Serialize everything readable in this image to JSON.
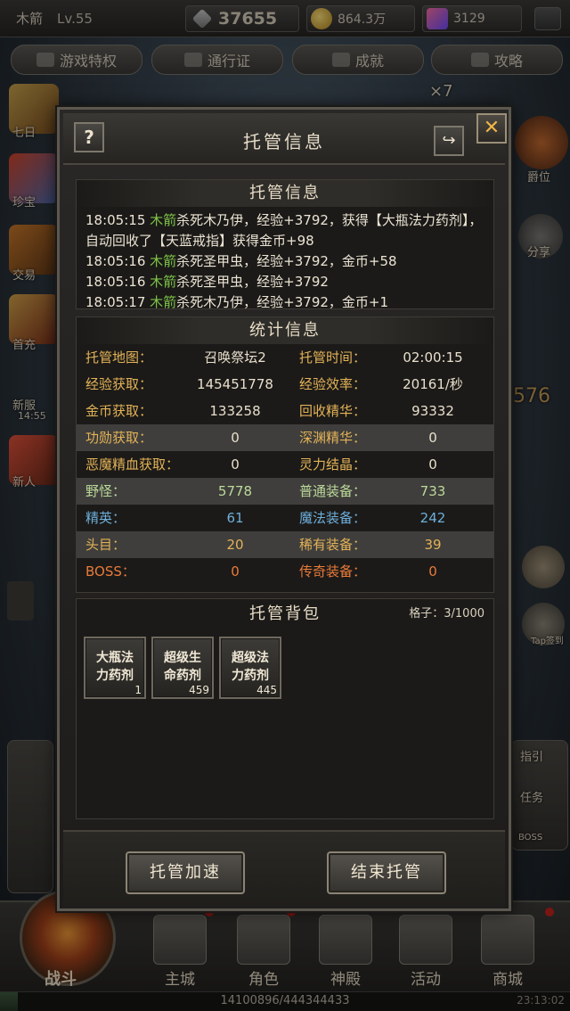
{
  "topbar": {
    "player_name": "木箭",
    "level": "Lv.55",
    "combat_power": "37655",
    "gold": "864.3万",
    "gems": "3129"
  },
  "menu": [
    "游戏特权",
    "通行证",
    "成就",
    "攻略"
  ],
  "side_labels": {
    "seven_day": "七日",
    "treasure": "珍宝",
    "auction": "交易",
    "first_charge": "首充",
    "new_server": "新服",
    "new_server_time": "14:55",
    "promo": "新人",
    "rank": "爵位",
    "share": "分享",
    "multiplier": "×7",
    "power_partial": "576",
    "tap_sign": "Tap签到",
    "guide": "指引",
    "task": "任务",
    "boss": "BOSS"
  },
  "dialog": {
    "title": "托管信息",
    "help_label": "?",
    "close_label": "✕",
    "share_label": "↪",
    "log_section": {
      "title": "托管信息",
      "entries": [
        {
          "time": "18:05:15",
          "name": "木箭",
          "text_before": "杀死木乃伊，经验+3792，获得【大瓶法力药剂】，自动回收了【天蓝戒指】获得金币+98"
        },
        {
          "time": "18:05:16",
          "name": "木箭",
          "text_before": "杀死圣甲虫，经验+3792，金币+58"
        },
        {
          "time": "18:05:16",
          "name": "木箭",
          "text_before": "杀死圣甲虫，经验+3792"
        },
        {
          "time": "18:05:17",
          "name": "木箭",
          "text_before": "杀死木乃伊，经验+3792，金币+1"
        }
      ]
    },
    "stats_section": {
      "title": "统计信息",
      "rows": [
        {
          "l1": "托管地图：",
          "v1": "召唤祭坛2",
          "l2": "托管时间：",
          "v2": "02:00:15",
          "alt": false,
          "color": "default"
        },
        {
          "l1": "经验获取：",
          "v1": "145451778",
          "l2": "经验效率：",
          "v2": "20161/秒",
          "alt": false,
          "color": "default"
        },
        {
          "l1": "金币获取：",
          "v1": "133258",
          "l2": "回收精华：",
          "v2": "93332",
          "alt": false,
          "color": "default"
        },
        {
          "l1": "功勋获取：",
          "v1": "0",
          "l2": "深渊精华：",
          "v2": "0",
          "alt": true,
          "color": "default"
        },
        {
          "l1": "恶魔精血获取：",
          "v1": "0",
          "l2": "灵力结晶：",
          "v2": "0",
          "alt": false,
          "color": "default"
        },
        {
          "l1": "野怪：",
          "v1": "5778",
          "l2": "普通装备：",
          "v2": "733",
          "alt": true,
          "color": "green"
        },
        {
          "l1": "精英：",
          "v1": "61",
          "l2": "魔法装备：",
          "v2": "242",
          "alt": false,
          "color": "blue"
        },
        {
          "l1": "头目：",
          "v1": "20",
          "l2": "稀有装备：",
          "v2": "39",
          "alt": true,
          "color": "gold"
        },
        {
          "l1": "BOSS：",
          "v1": "0",
          "l2": "传奇装备：",
          "v2": "0",
          "alt": false,
          "color": "orange"
        }
      ]
    },
    "bag_section": {
      "title": "托管背包",
      "slots": "格子：3/1000",
      "items": [
        {
          "name": "大瓶法力药剂",
          "count": "1"
        },
        {
          "name": "超级生命药剂",
          "count": "459"
        },
        {
          "name": "超级法力药剂",
          "count": "445"
        }
      ]
    },
    "buttons": {
      "speed_up": "托管加速",
      "end": "结束托管"
    }
  },
  "bottom_nav": {
    "battle": "战斗",
    "items": [
      "主城",
      "角色",
      "神殿",
      "活动",
      "商城"
    ],
    "exp_text": "14100896/444344433",
    "exp_fraction": 0.0317,
    "right_text": "23:13:02"
  },
  "colors": {
    "green": "#7cc247",
    "blue": "#6eaeda",
    "gold": "#e3b257",
    "orange": "#ea7a3a"
  }
}
